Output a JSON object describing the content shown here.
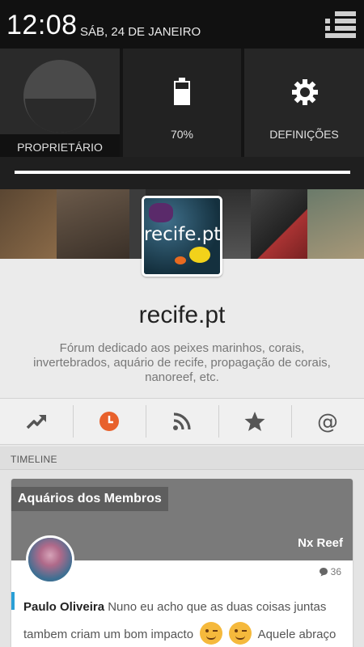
{
  "status_bar": {
    "time": "12:08",
    "date": "SÁB, 24 DE JANEIRO"
  },
  "quick_settings": {
    "owner_label": "PROPRIETÁRIO",
    "battery_label": "70%",
    "battery_level": 0.7,
    "settings_label": "DEFINIÇÕES",
    "brightness_level": 1.0
  },
  "forum": {
    "logo_text": "recife.pt",
    "title": "recife.pt",
    "description": "Fórum dedicado aos peixes marinhos, corais, invertebrados, aquário de recife, propagação de corais, nanoreef, etc."
  },
  "tabs": [
    {
      "icon": "trending-icon",
      "active": false
    },
    {
      "icon": "clock-icon",
      "active": true
    },
    {
      "icon": "rss-icon",
      "active": false
    },
    {
      "icon": "star-icon",
      "active": false
    },
    {
      "icon": "at-icon",
      "active": false
    }
  ],
  "timeline": {
    "header": "TIMELINE",
    "post": {
      "category": "Aquários dos Membros",
      "thread_author": "Nx Reef",
      "reply_count": "36",
      "author": "Paulo Oliveira",
      "text_part1": "Nuno eu acho que as duas coisas juntas tambem criam um bom impacto",
      "text_part2": "Aquele abraço"
    }
  },
  "colors": {
    "accent_orange": "#e8612c",
    "quote_bar": "#2a9fd6"
  }
}
